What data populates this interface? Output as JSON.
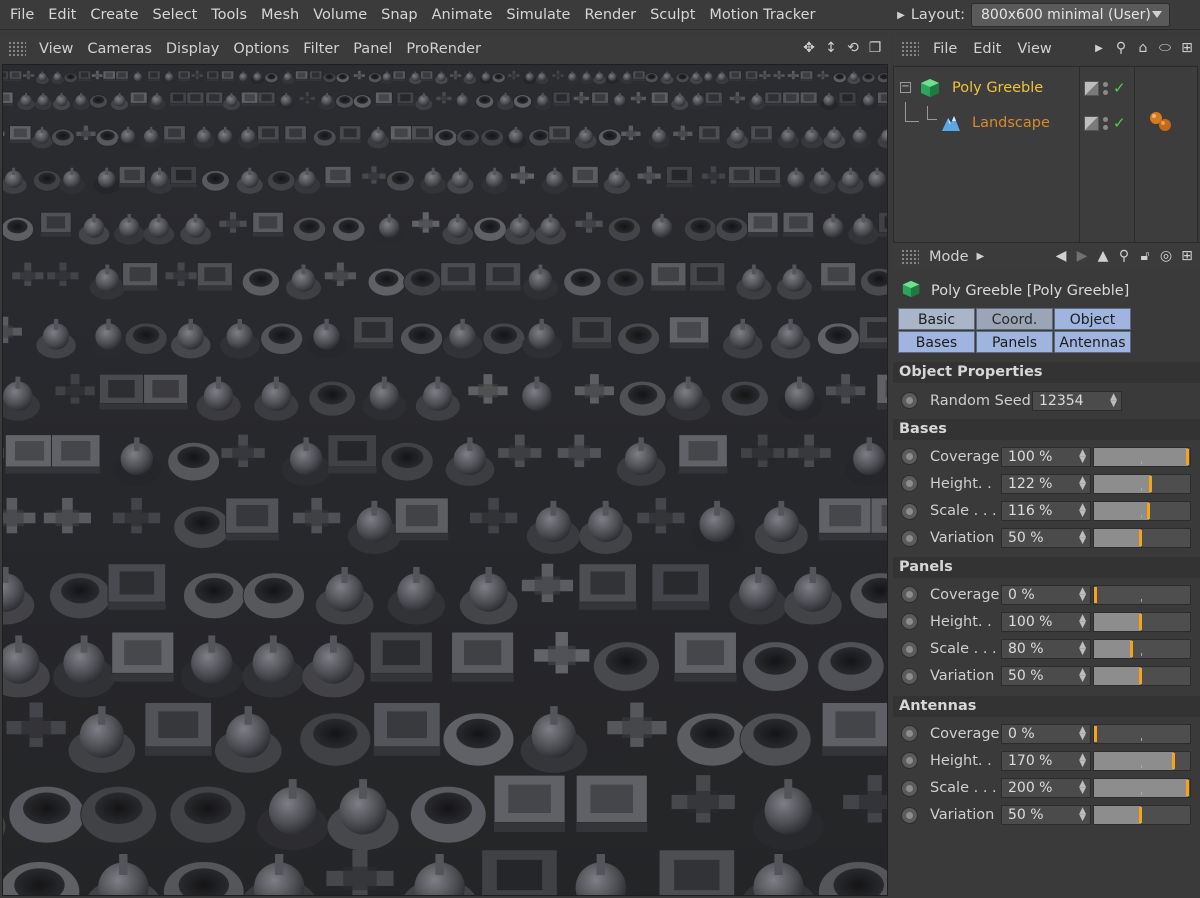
{
  "menubar": {
    "items": [
      "File",
      "Edit",
      "Create",
      "Select",
      "Tools",
      "Mesh",
      "Volume",
      "Snap",
      "Animate",
      "Simulate",
      "Render",
      "Sculpt",
      "Motion Tracker"
    ],
    "layout_label": "Layout:",
    "layout_value": "800x600 minimal (User)"
  },
  "viewport": {
    "menu": [
      "View",
      "Cameras",
      "Display",
      "Options",
      "Filter",
      "Panel",
      "ProRender"
    ],
    "tool_icons": [
      "move-view-icon",
      "dolly-view-icon",
      "rotate-view-icon",
      "maximize-view-icon"
    ]
  },
  "object_manager": {
    "menu": [
      "File",
      "Edit",
      "View"
    ],
    "objects": [
      {
        "name": "Poly Greeble",
        "color": "#f2c23a",
        "icon": "poly-greeble-icon"
      },
      {
        "name": "Landscape",
        "color": "#d98a2b",
        "icon": "landscape-icon"
      }
    ]
  },
  "attribute_manager": {
    "mode_label": "Mode",
    "object_title": "Poly Greeble [Poly Greeble]",
    "tabs": [
      "Basic",
      "Coord.",
      "Object",
      "Bases",
      "Panels",
      "Antennas"
    ],
    "sections": {
      "object_properties": {
        "title": "Object Properties",
        "random_seed_label": "Random Seed",
        "random_seed_value": "12354"
      },
      "bases": {
        "title": "Bases",
        "params": [
          {
            "label": "Coverage",
            "value": "100 %",
            "level": 1.0
          },
          {
            "label": "Height. .",
            "value": "122 %",
            "level": 0.61
          },
          {
            "label": "Scale . . .",
            "value": "116 %",
            "level": 0.58
          },
          {
            "label": "Variation",
            "value": "50 %",
            "level": 0.5
          }
        ]
      },
      "panels": {
        "title": "Panels",
        "params": [
          {
            "label": "Coverage",
            "value": "0 %",
            "level": 0.0
          },
          {
            "label": "Height. .",
            "value": "100 %",
            "level": 0.5
          },
          {
            "label": "Scale . . .",
            "value": "80 %",
            "level": 0.4
          },
          {
            "label": "Variation",
            "value": "50 %",
            "level": 0.5
          }
        ]
      },
      "antennas": {
        "title": "Antennas",
        "params": [
          {
            "label": "Coverage",
            "value": "0 %",
            "level": 0.0
          },
          {
            "label": "Height. .",
            "value": "170 %",
            "level": 0.85
          },
          {
            "label": "Scale . . .",
            "value": "200 %",
            "level": 1.0
          },
          {
            "label": "Variation",
            "value": "50 %",
            "level": 0.5
          }
        ]
      }
    }
  },
  "colors": {
    "accent_orange": "#f6a21b",
    "tab_active": "#9fb4de",
    "check_green": "#4ad14a"
  }
}
